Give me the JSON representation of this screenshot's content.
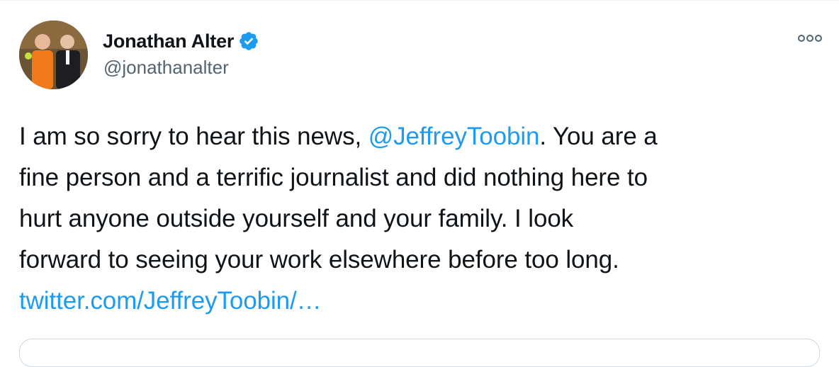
{
  "author": {
    "display_name": "Jonathan Alter",
    "handle": "@jonathanalter",
    "verified": true
  },
  "tweet": {
    "line1_before": "I am so sorry to hear this news, ",
    "mention": "@JeffreyToobin",
    "line1_after": ". You are a",
    "line2": "fine person and a terrific journalist and did nothing here to",
    "line3": "hurt anyone outside yourself and your family. I look",
    "line4": "forward to seeing your work elsewhere before too long.",
    "link": "twitter.com/JeffreyToobin/…"
  },
  "icons": {
    "verified": "verified-badge-icon",
    "more": "more-options-icon"
  },
  "colors": {
    "link": "#1d9bf0",
    "text": "#0f1419",
    "secondary": "#536471",
    "verified": "#1d9bf0"
  }
}
